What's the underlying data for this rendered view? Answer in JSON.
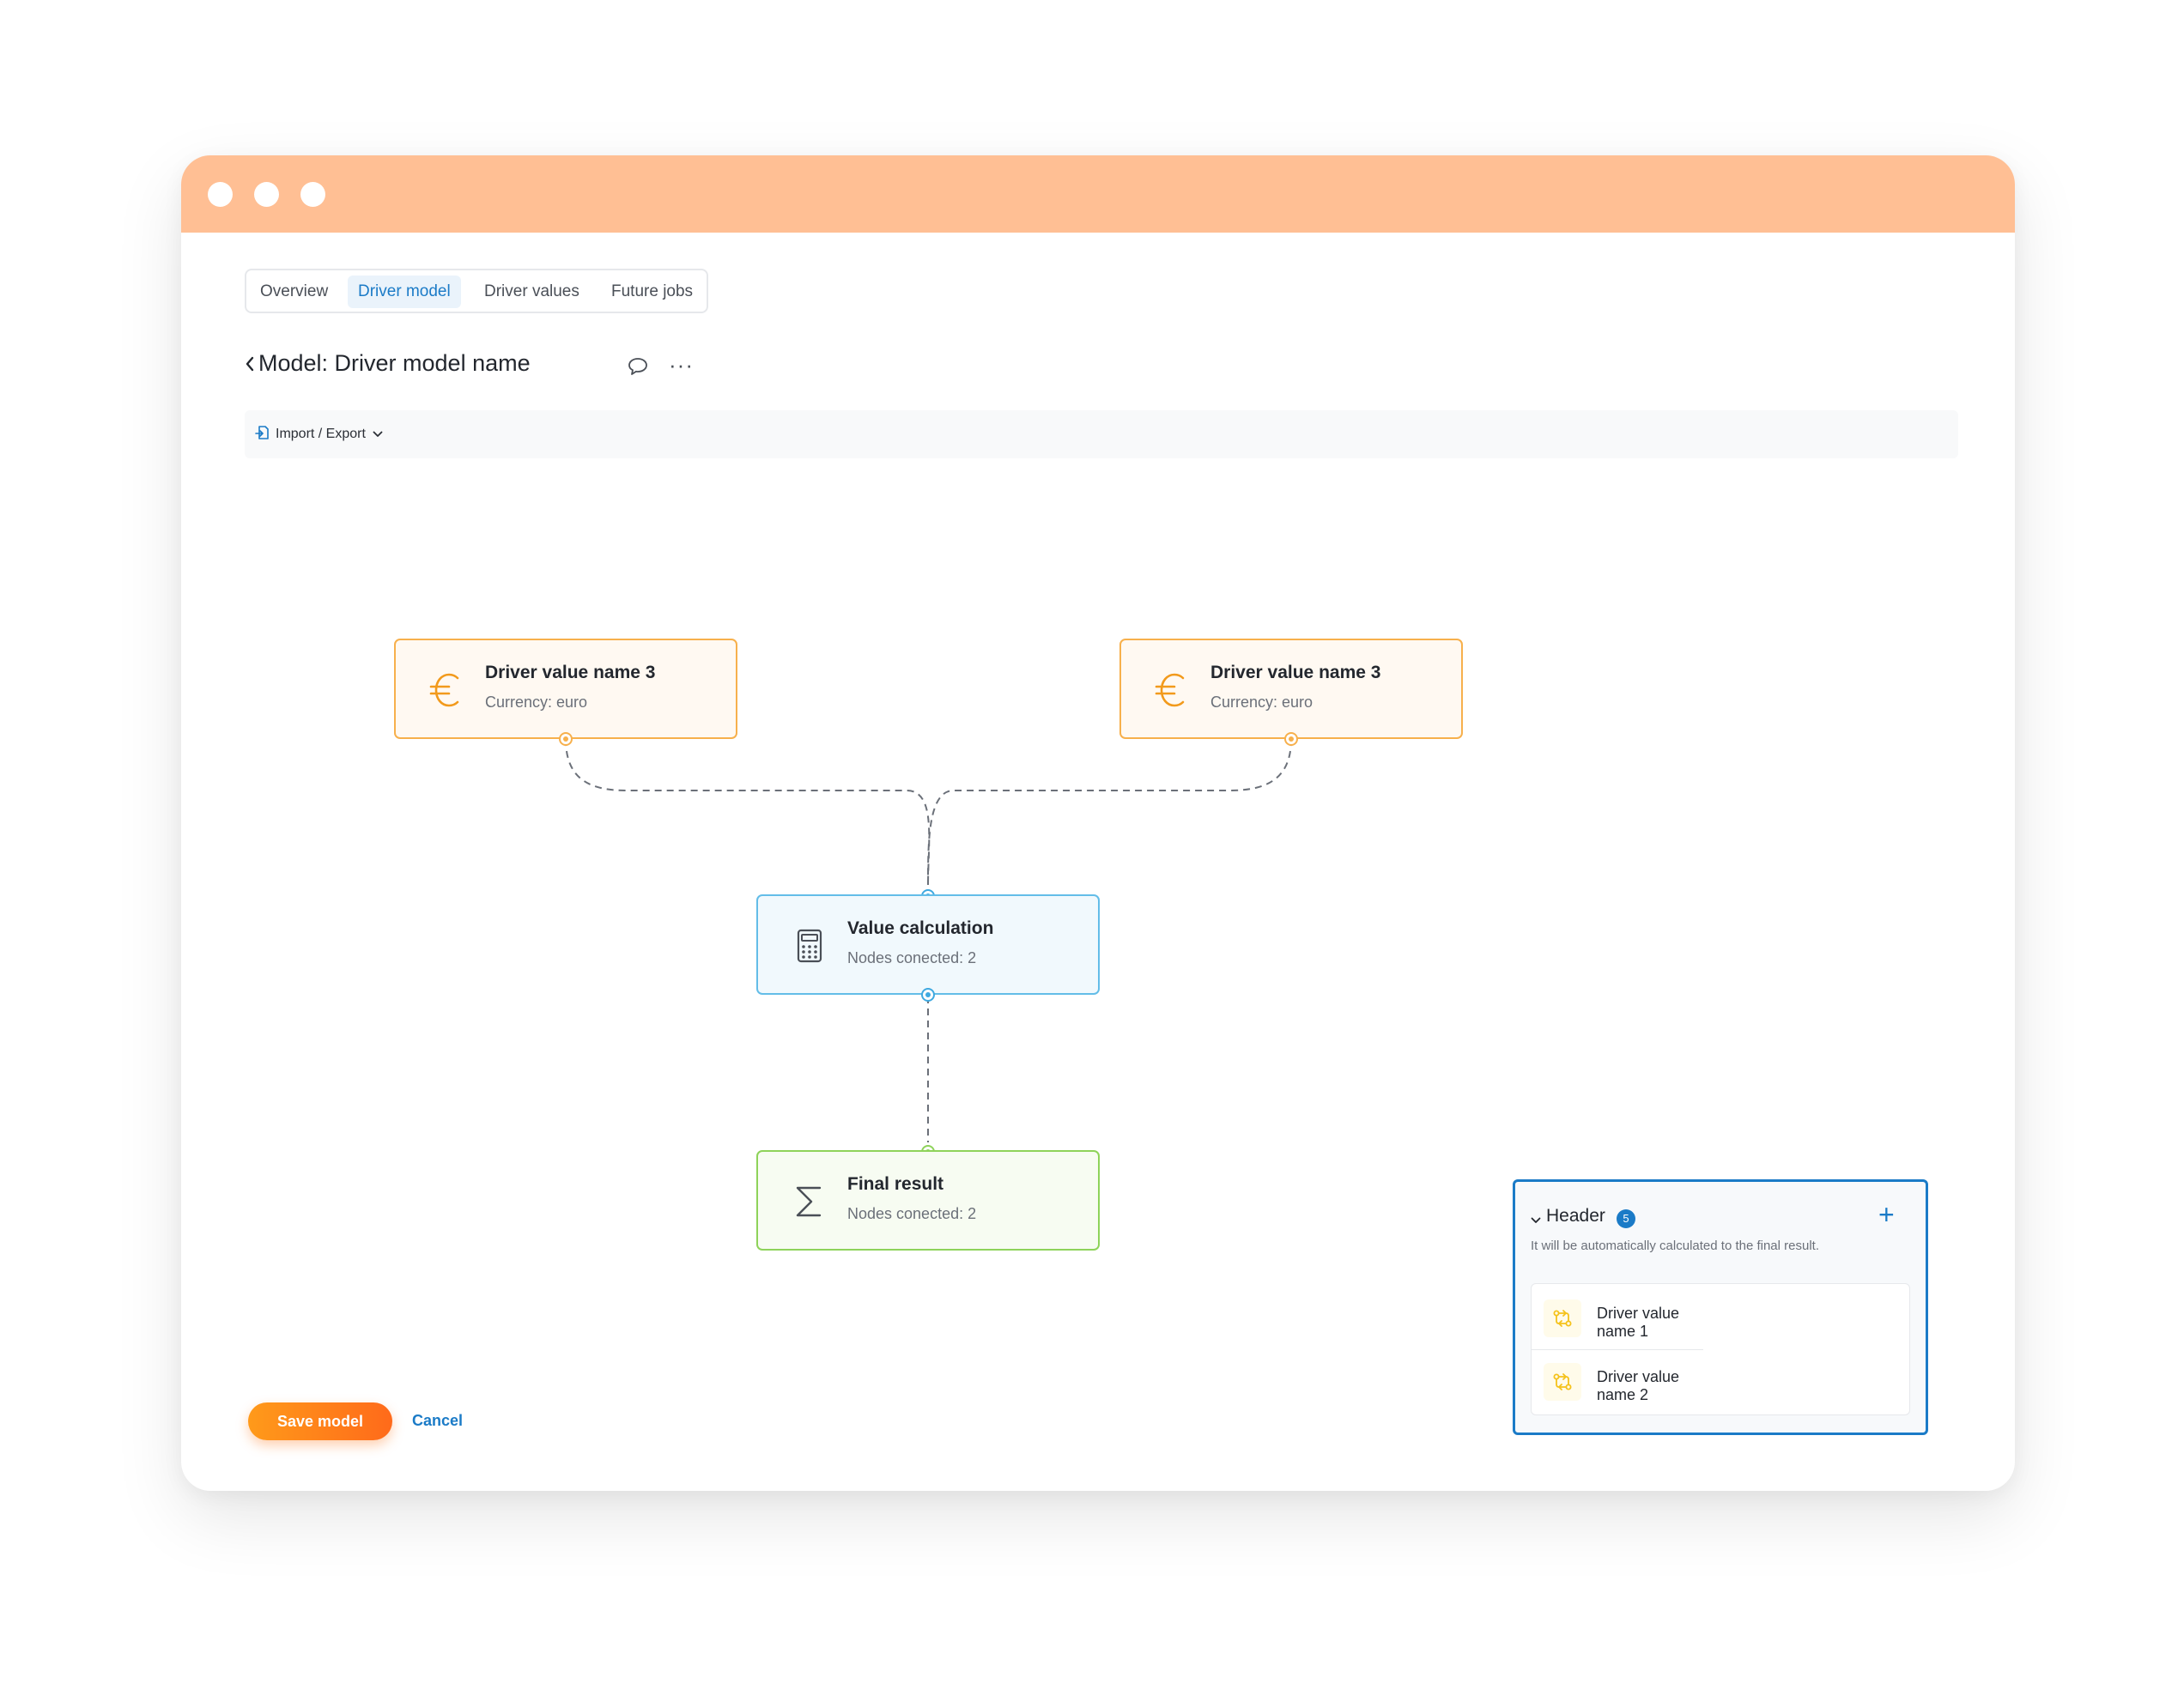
{
  "tabs": [
    "Overview",
    "Driver model",
    "Driver values",
    "Future jobs"
  ],
  "active_tab": "Driver model",
  "page": {
    "title": "Model: Driver model name"
  },
  "toolbar": {
    "import_export_label": "Import / Export"
  },
  "nodes": {
    "driver_left": {
      "title": "Driver value name 3",
      "subtitle": "Currency: euro"
    },
    "driver_right": {
      "title": "Driver value name 3",
      "subtitle": "Currency: euro"
    },
    "calculation": {
      "title": "Value calculation",
      "subtitle": "Nodes conected: 2"
    },
    "final": {
      "title": "Final result",
      "subtitle": "Nodes conected: 2"
    }
  },
  "actions": {
    "save_label": "Save model",
    "cancel_label": "Cancel"
  },
  "panel": {
    "title": "Header",
    "badge": "5",
    "description": "It will be automatically calculated to the final result.",
    "items": [
      "Driver value name 1",
      "Driver value name 2"
    ]
  },
  "colors": {
    "titlebar": "#ffbf94",
    "accent_blue": "#1b7bc7",
    "driver_border": "#f7b04c",
    "calculation_border": "#63bde8",
    "final_border": "#8ed35a",
    "save_gradient_start": "#ff9a1a",
    "save_gradient_end": "#ff6a1a"
  },
  "icons": {
    "driver": "euro-icon",
    "calculation": "calculator-icon",
    "final": "sigma-icon",
    "panel_item": "driver-value-icon"
  }
}
